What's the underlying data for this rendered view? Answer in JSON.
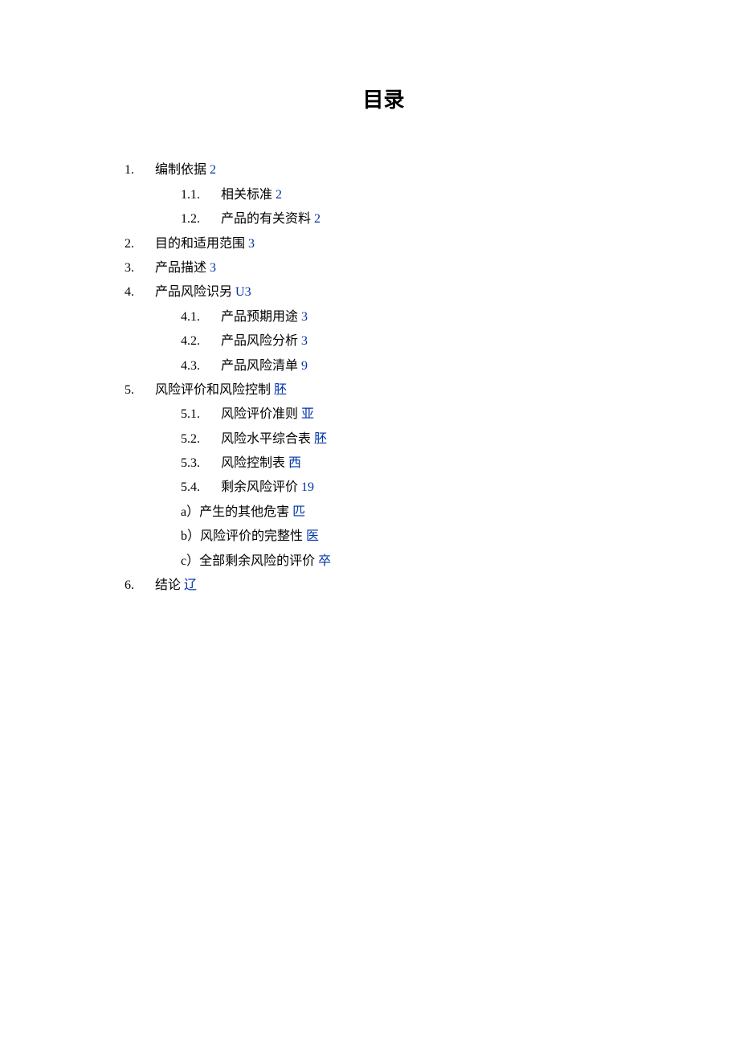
{
  "title": "目录",
  "toc": [
    {
      "num": "1.",
      "title": "编制依据",
      "page": "2",
      "sub": [
        {
          "num": "1.1.",
          "title": "相关标准",
          "page": "2"
        },
        {
          "num": "1.2.",
          "title": "产品的有关资料",
          "page": "2"
        }
      ]
    },
    {
      "num": "2.",
      "title": "目的和适用范围",
      "page": "3",
      "sub": []
    },
    {
      "num": "3.",
      "title": "产品描述",
      "page": "3",
      "sub": []
    },
    {
      "num": "4.",
      "title": "产品风险识另",
      "page": "U3",
      "sub": [
        {
          "num": "4.1.",
          "title": "产品预期用途",
          "page": "3"
        },
        {
          "num": "4.2.",
          "title": "产品风险分析",
          "page": "3"
        },
        {
          "num": "4.3.",
          "title": "产品风险清单",
          "page": "9"
        }
      ]
    },
    {
      "num": "5.",
      "title": "风险评价和风险控制",
      "page": "胚",
      "sub": [
        {
          "num": "5.1.",
          "title": "风险评价准则",
          "page": "亚"
        },
        {
          "num": "5.2.",
          "title": "风险水平综合表",
          "page": "胚"
        },
        {
          "num": "5.3.",
          "title": "风险控制表",
          "page": "西"
        },
        {
          "num": "5.4.",
          "title": "剩余风险评价",
          "page": "19"
        },
        {
          "alpha": "a）",
          "title": "产生的其他危害",
          "page": "匹"
        },
        {
          "alpha": "b）",
          "title": "风险评价的完整性",
          "page": "医"
        },
        {
          "alpha": "c）",
          "title": "全部剩余风险的评价",
          "page": "卒"
        }
      ]
    },
    {
      "num": "6.",
      "title": "结论",
      "page": "辽",
      "sub": []
    }
  ]
}
